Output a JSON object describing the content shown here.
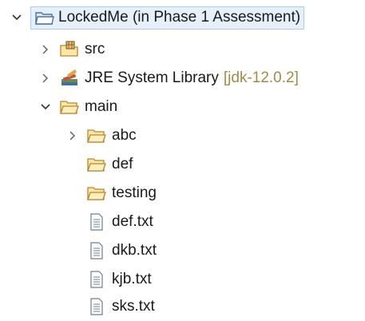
{
  "tree": {
    "project": {
      "label": "LockedMe (in Phase 1 Assessment)",
      "icon": "project-folder-icon",
      "expanded": true
    },
    "src": {
      "label": "src",
      "icon": "package-folder-icon",
      "expanded": false
    },
    "jre": {
      "label": "JRE System Library",
      "decoration": "[jdk-12.0.2]",
      "icon": "library-icon",
      "expanded": false
    },
    "main": {
      "label": "main",
      "icon": "folder-open-icon",
      "expanded": true
    },
    "abc": {
      "label": "abc",
      "icon": "folder-icon",
      "expanded": false
    },
    "def": {
      "label": "def",
      "icon": "folder-icon"
    },
    "testing": {
      "label": "testing",
      "icon": "folder-icon"
    },
    "files": [
      {
        "label": "def.txt",
        "icon": "text-file-icon"
      },
      {
        "label": "dkb.txt",
        "icon": "text-file-icon"
      },
      {
        "label": "kjb.txt",
        "icon": "text-file-icon"
      },
      {
        "label": "sks.txt",
        "icon": "text-file-icon"
      }
    ]
  },
  "colors": {
    "selection_bg": "#e6f0fa",
    "selection_border": "#a9cdee",
    "folder_fill": "#fce7a6",
    "folder_stroke": "#b8862b",
    "decoration_text": "#a38b44"
  }
}
